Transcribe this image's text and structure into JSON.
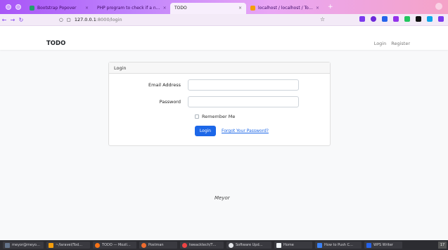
{
  "browser": {
    "tabs": [
      {
        "label": "Bootstrap Popover",
        "close": "×"
      },
      {
        "label": "PHP program to check if a n…",
        "close": "×"
      },
      {
        "label": "TODO",
        "close": "×"
      },
      {
        "label": "localhost / localhost / To…",
        "close": "×"
      }
    ],
    "new_tab": "+",
    "url_host": "127.0.0.1",
    "url_rest": ":8000/login"
  },
  "app": {
    "brand": "TODO",
    "nav": {
      "login": "Login",
      "register": "Register"
    }
  },
  "login_card": {
    "header": "Login",
    "email_label": "Email Address",
    "email_value": "",
    "password_label": "Password",
    "password_value": "",
    "remember_label": "Remember Me",
    "login_button": "Login",
    "forgot_link": "Forgot Your Password?"
  },
  "footer": {
    "text": "Meyor"
  },
  "taskbar": {
    "items": [
      {
        "label": "meyor@meyo…"
      },
      {
        "label": "~/laravel/Tod…"
      },
      {
        "label": "TODO — Mozil…"
      },
      {
        "label": "Postman"
      },
      {
        "label": "tweacktech/T…"
      },
      {
        "label": "Software Upd…"
      },
      {
        "label": "Home"
      },
      {
        "label": "How to Push C…"
      },
      {
        "label": "WPS Writer"
      }
    ],
    "tray": "17"
  },
  "colors": {
    "primary": "#1c67e8",
    "tab_gradient_start": "#a855f7"
  }
}
